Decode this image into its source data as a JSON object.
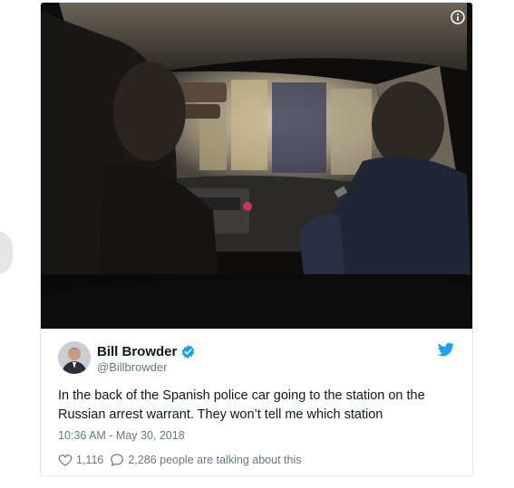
{
  "media": {
    "alt_icon": "info-icon"
  },
  "tweet": {
    "author": {
      "name": "Bill Browder",
      "handle": "@Billbrowder",
      "verified": true,
      "verified_icon": "verified-badge-icon"
    },
    "platform_icon": "twitter-bird-icon",
    "text": "In the back of the Spanish police car going to the station on the Russian arrest warrant. They won’t tell me which station",
    "timestamp": "10:36 AM - May 30, 2018",
    "likes": "1,116",
    "talking_text": "2,286 people are talking about this",
    "like_icon": "heart-icon",
    "reply_icon": "speech-bubble-icon"
  },
  "colors": {
    "brand_blue": "#1da1f2",
    "text_primary": "#14171a",
    "text_secondary": "#657786",
    "border": "#e1e8ed"
  }
}
